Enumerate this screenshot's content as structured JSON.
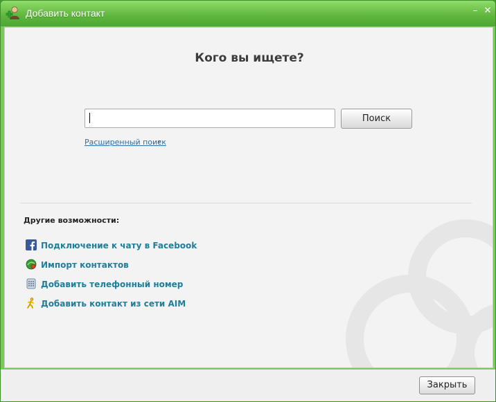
{
  "window": {
    "title": "Добавить контакт",
    "minimize_glyph": "–",
    "close_glyph": "✕"
  },
  "search": {
    "heading": "Кого вы ищете?",
    "value": "",
    "button_label": "Поиск",
    "advanced_link": "Расширенный поиск",
    "advanced_chevron": "»"
  },
  "other": {
    "heading": "Другие возможности:",
    "options": [
      {
        "label": "Подключение к чату в Facebook",
        "icon": "facebook-icon"
      },
      {
        "label": "Импорт контактов",
        "icon": "import-contacts-icon"
      },
      {
        "label": "Добавить телефонный номер",
        "icon": "phone-icon"
      },
      {
        "label": "Добавить контакт из сети AIM",
        "icon": "aim-icon"
      }
    ]
  },
  "footer": {
    "close_label": "Закрыть"
  },
  "colors": {
    "titlebar": "#5fb53e",
    "link": "#1f7e9a",
    "content_bg": "#f3f3f3"
  }
}
